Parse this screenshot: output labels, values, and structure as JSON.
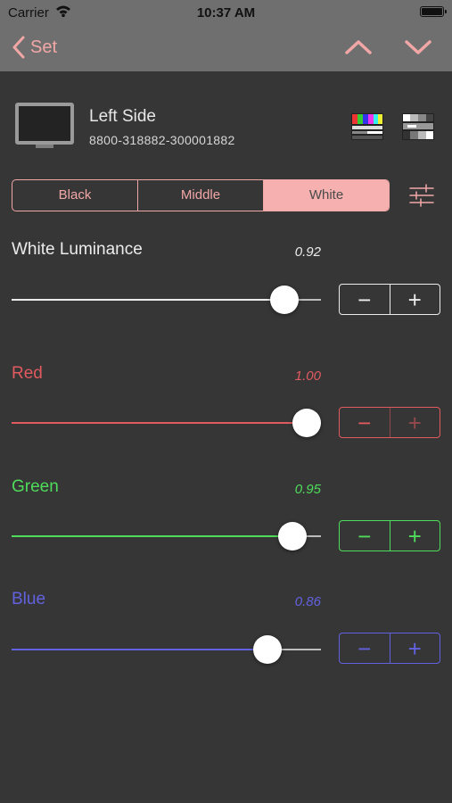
{
  "status_bar": {
    "carrier": "Carrier",
    "time": "10:37 AM"
  },
  "nav": {
    "back_label": "Set",
    "icons": [
      "chevron-left-icon",
      "chevron-up-icon",
      "chevron-down-icon"
    ]
  },
  "device": {
    "name": "Left Side",
    "serial": "8800-318882-300001882"
  },
  "segments": {
    "items": [
      "Black",
      "Middle",
      "White"
    ],
    "selected": "White"
  },
  "adjustments": [
    {
      "label": "White Luminance",
      "value": "0.92",
      "level": 0.92,
      "color": "#ececec"
    },
    {
      "label": "Red",
      "value": "1.00",
      "level": 1.0,
      "color": "#e05a5f"
    },
    {
      "label": "Green",
      "value": "0.95",
      "level": 0.95,
      "color": "#4fdc5a"
    },
    {
      "label": "Blue",
      "value": "0.86",
      "level": 0.86,
      "color": "#6262e0"
    }
  ],
  "stepper": {
    "minus": "−",
    "plus": "+"
  },
  "colors": {
    "accent": "#f2a7a7",
    "background": "#363636",
    "bar": "#6f6f6f"
  }
}
